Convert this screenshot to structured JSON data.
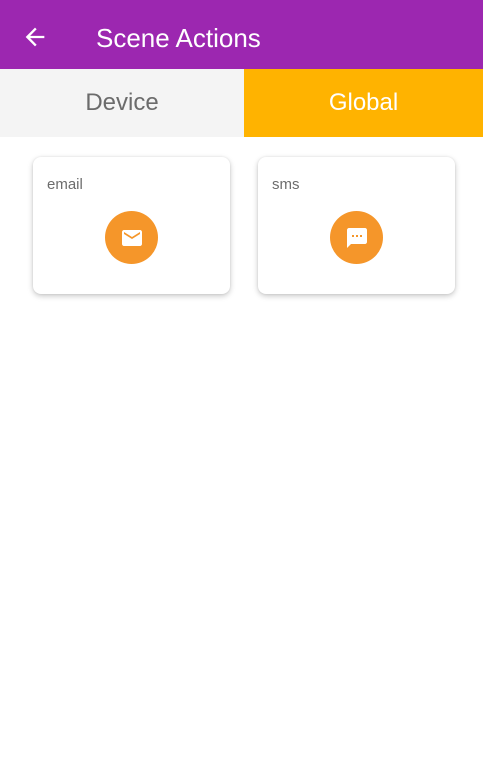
{
  "appbar": {
    "title": "Scene Actions",
    "back_icon": "arrow-left-icon",
    "background": "#9c27b0"
  },
  "tabs": [
    {
      "label": "Device",
      "selected": false
    },
    {
      "label": "Global",
      "selected": true,
      "accent": "#ffb300"
    }
  ],
  "actions": [
    {
      "label": "email",
      "icon": "envelope-icon",
      "icon_color": "#f5962a"
    },
    {
      "label": "sms",
      "icon": "chat-bubble-icon",
      "icon_color": "#f5962a"
    }
  ]
}
